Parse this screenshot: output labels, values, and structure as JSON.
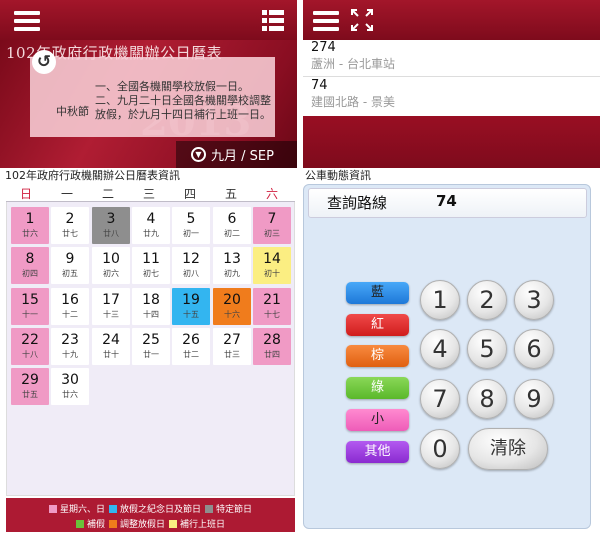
{
  "left": {
    "banner": {
      "title": "102年政府行政機關辦公日曆表",
      "festival": "中秋節",
      "year_watermark": "2013",
      "notes": [
        "一、全國各機關學校放假一日。",
        "二、九月二十日全國各機關學校調整放假，於九月十四日補行上班一日。"
      ],
      "month": "九月 / SEP"
    },
    "section_title": "102年政府行政機關辦公日曆表資訊",
    "weekdays": [
      "日",
      "一",
      "二",
      "三",
      "四",
      "五",
      "六"
    ],
    "days": [
      {
        "d": "1",
        "l": "廿六",
        "type": "pink"
      },
      {
        "d": "2",
        "l": "廿七",
        "type": "normal"
      },
      {
        "d": "3",
        "l": "廿八",
        "type": "gray"
      },
      {
        "d": "4",
        "l": "廿九",
        "type": "normal"
      },
      {
        "d": "5",
        "l": "初一",
        "type": "normal"
      },
      {
        "d": "6",
        "l": "初二",
        "type": "normal"
      },
      {
        "d": "7",
        "l": "初三",
        "type": "pink"
      },
      {
        "d": "8",
        "l": "初四",
        "type": "pink"
      },
      {
        "d": "9",
        "l": "初五",
        "type": "normal"
      },
      {
        "d": "10",
        "l": "初六",
        "type": "normal"
      },
      {
        "d": "11",
        "l": "初七",
        "type": "normal"
      },
      {
        "d": "12",
        "l": "初八",
        "type": "normal"
      },
      {
        "d": "13",
        "l": "初九",
        "type": "normal"
      },
      {
        "d": "14",
        "l": "初十",
        "type": "yellow"
      },
      {
        "d": "15",
        "l": "十一",
        "type": "pink"
      },
      {
        "d": "16",
        "l": "十二",
        "type": "normal"
      },
      {
        "d": "17",
        "l": "十三",
        "type": "normal"
      },
      {
        "d": "18",
        "l": "十四",
        "type": "normal"
      },
      {
        "d": "19",
        "l": "十五",
        "type": "blue"
      },
      {
        "d": "20",
        "l": "十六",
        "type": "orange"
      },
      {
        "d": "21",
        "l": "十七",
        "type": "pink"
      },
      {
        "d": "22",
        "l": "十八",
        "type": "pink"
      },
      {
        "d": "23",
        "l": "十九",
        "type": "normal"
      },
      {
        "d": "24",
        "l": "廿十",
        "type": "normal"
      },
      {
        "d": "25",
        "l": "廿一",
        "type": "normal"
      },
      {
        "d": "26",
        "l": "廿二",
        "type": "normal"
      },
      {
        "d": "27",
        "l": "廿三",
        "type": "normal"
      },
      {
        "d": "28",
        "l": "廿四",
        "type": "pink"
      },
      {
        "d": "29",
        "l": "廿五",
        "type": "pink"
      },
      {
        "d": "30",
        "l": "廿六",
        "type": "normal"
      }
    ],
    "legend": {
      "row1": [
        {
          "label": "星期六、日",
          "color": "#f09ac5"
        },
        {
          "label": "放假之紀念日及節日",
          "color": "#33b5f0"
        },
        {
          "label": "特定節日",
          "color": "#8e8e8e"
        }
      ],
      "row2": [
        {
          "label": "補假",
          "color": "#6ac23a"
        },
        {
          "label": "調整放假日",
          "color": "#f07c1c"
        },
        {
          "label": "補行上班日",
          "color": "#fbee82"
        }
      ]
    }
  },
  "right": {
    "results": [
      {
        "num": "274",
        "route": "蘆洲 - 台北車站"
      },
      {
        "num": "74",
        "route": "建國北路 - 景美"
      }
    ],
    "section_title": "公車動態資訊",
    "query_label": "查詢路線",
    "query_value": "74",
    "color_buttons": [
      {
        "label": "藍",
        "style": "blue"
      },
      {
        "label": "紅",
        "style": "red"
      },
      {
        "label": "棕",
        "style": "brown"
      },
      {
        "label": "綠",
        "style": "green"
      },
      {
        "label": "小",
        "style": "pink"
      },
      {
        "label": "其他",
        "style": "purple"
      }
    ],
    "keys": [
      "1",
      "2",
      "3",
      "4",
      "5",
      "6",
      "7",
      "8",
      "9",
      "0"
    ],
    "clear_label": "清除"
  },
  "colors": {
    "header_red": "#a3162a",
    "saturday_sunday_text": "#d02040",
    "board_bg": "#dce8f6"
  }
}
